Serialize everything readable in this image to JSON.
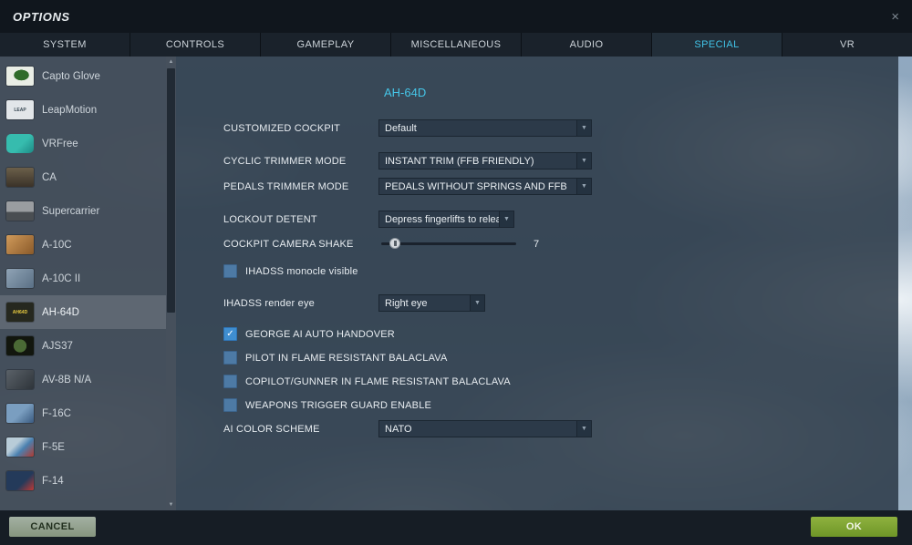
{
  "window": {
    "title": "OPTIONS"
  },
  "icons": {
    "close": "×",
    "dropdown_arrow": "▼",
    "check": "✓",
    "scroll_up": "▲",
    "scroll_down": "▼"
  },
  "colors": {
    "accent_cyan": "#45c6e8",
    "ok_green": "#7da235",
    "cancel_gray_green": "#97a697",
    "checkbox_blue": "#4d7aa5",
    "checkbox_checked_blue": "#3f8ed0",
    "panel_dark": "#2c3947"
  },
  "tabs": {
    "items": [
      {
        "label": "SYSTEM",
        "active": false
      },
      {
        "label": "CONTROLS",
        "active": false
      },
      {
        "label": "GAMEPLAY",
        "active": false
      },
      {
        "label": "MISCELLANEOUS",
        "active": false
      },
      {
        "label": "AUDIO",
        "active": false
      },
      {
        "label": "SPECIAL",
        "active": true
      },
      {
        "label": "VR",
        "active": false
      }
    ]
  },
  "sidebar": {
    "items": [
      {
        "label": "Capto Glove",
        "selected": false
      },
      {
        "label": "LeapMotion",
        "selected": false,
        "icon_text": "LEAP"
      },
      {
        "label": "VRFree",
        "selected": false
      },
      {
        "label": "CA",
        "selected": false
      },
      {
        "label": "Supercarrier",
        "selected": false
      },
      {
        "label": "A-10C",
        "selected": false
      },
      {
        "label": "A-10C II",
        "selected": false
      },
      {
        "label": "AH-64D",
        "selected": true,
        "icon_text": "AH64D"
      },
      {
        "label": "AJS37",
        "selected": false
      },
      {
        "label": "AV-8B N/A",
        "selected": false
      },
      {
        "label": "F-16C",
        "selected": false
      },
      {
        "label": "F-5E",
        "selected": false
      },
      {
        "label": "F-14",
        "selected": false
      }
    ]
  },
  "main": {
    "title": "AH-64D",
    "customized_cockpit": {
      "label": "CUSTOMIZED COCKPIT",
      "value": "Default"
    },
    "cyclic_trimmer": {
      "label": "CYCLIC TRIMMER MODE",
      "value": "INSTANT TRIM (FFB FRIENDLY)"
    },
    "pedals_trimmer": {
      "label": "PEDALS TRIMMER MODE",
      "value": "PEDALS WITHOUT SPRINGS AND FFB"
    },
    "lockout_detent": {
      "label": "LOCKOUT DETENT",
      "value": "Depress fingerlifts to release"
    },
    "camera_shake": {
      "label": "COCKPIT CAMERA SHAKE",
      "value": "7"
    },
    "ihadss_monocle": {
      "label": "IHADSS monocle visible",
      "checked": false
    },
    "ihadss_render_eye": {
      "label": "IHADSS render eye",
      "value": "Right eye"
    },
    "george_handover": {
      "label": "GEORGE AI AUTO HANDOVER",
      "checked": true
    },
    "pilot_balaclava": {
      "label": "PILOT IN FLAME RESISTANT BALACLAVA",
      "checked": false
    },
    "copilot_balaclava": {
      "label": "COPILOT/GUNNER IN FLAME RESISTANT BALACLAVA",
      "checked": false
    },
    "weapons_guard": {
      "label": "WEAPONS TRIGGER GUARD ENABLE",
      "checked": false
    },
    "ai_color_scheme": {
      "label": "AI COLOR SCHEME",
      "value": "NATO"
    }
  },
  "footer": {
    "cancel_label": "CANCEL",
    "ok_label": "OK"
  }
}
